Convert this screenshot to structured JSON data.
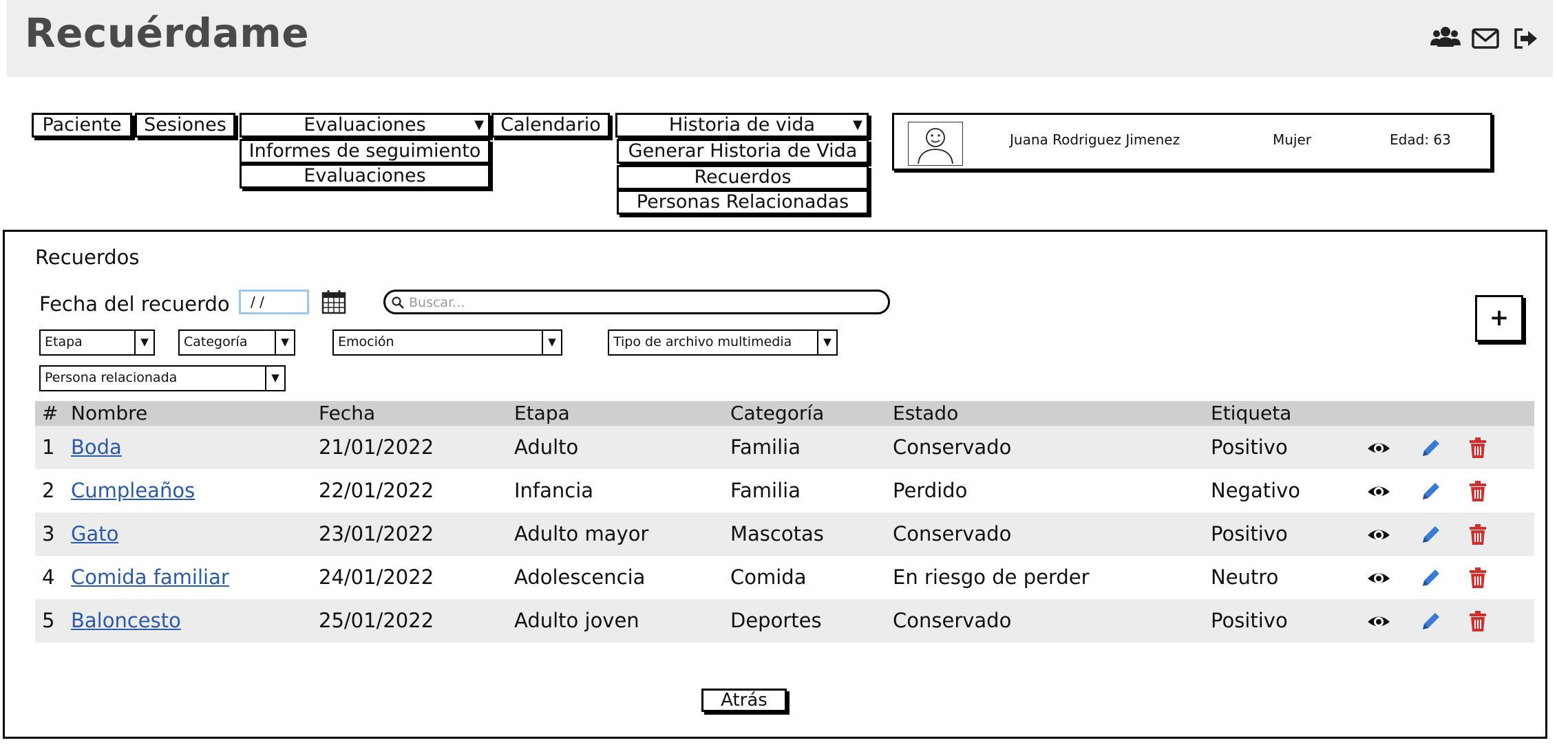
{
  "app": {
    "title": "Recuérdame"
  },
  "header_icons": [
    "users-icon",
    "mail-icon",
    "logout-icon"
  ],
  "menu": {
    "paciente": "Paciente",
    "sesiones": "Sesiones",
    "evaluaciones": {
      "label": "Evaluaciones",
      "items": [
        "Informes de seguimiento",
        "Evaluaciones"
      ]
    },
    "calendario": "Calendario",
    "historia": {
      "label": "Historia de vida",
      "items": [
        "Generar Historia de Vida",
        "Recuerdos",
        "Personas Relacionadas"
      ]
    }
  },
  "patient": {
    "name": "Juana Rodriguez Jimenez",
    "gender": "Mujer",
    "age": "Edad: 63"
  },
  "section": {
    "title": "Recuerdos"
  },
  "filters": {
    "date_label": "Fecha del recuerdo",
    "date_value": " / /",
    "search_placeholder": "Buscar...",
    "add_label": "+",
    "etapa": "Etapa",
    "categoria": "Categoría",
    "emocion": "Emoción",
    "tipo": "Tipo de archivo multimedia",
    "persona": "Persona relacionada"
  },
  "table": {
    "columns": [
      "#",
      "Nombre",
      "Fecha",
      "Etapa",
      "Categoría",
      "Estado",
      "Etiqueta"
    ],
    "rows": [
      [
        "1",
        "Boda",
        "21/01/2022",
        "Adulto",
        "Familia",
        "Conservado",
        "Positivo"
      ],
      [
        "2",
        "Cumpleaños",
        "22/01/2022",
        "Infancia",
        "Familia",
        "Perdido",
        "Negativo"
      ],
      [
        "3",
        "Gato",
        "23/01/2022",
        "Adulto mayor",
        "Mascotas",
        "Conservado",
        "Positivo"
      ],
      [
        "4",
        "Comida familiar",
        "24/01/2022",
        "Adolescencia",
        "Comida",
        "En riesgo de perder",
        "Neutro"
      ],
      [
        "5",
        "Baloncesto",
        "25/01/2022",
        "Adulto joven",
        "Deportes",
        "Conservado",
        "Positivo"
      ]
    ]
  },
  "colors": {
    "link": "#2a5aa8",
    "edit": "#3a7bd5",
    "delete": "#d02f2f",
    "header_bg": "#eeeeee"
  },
  "footer": {
    "back_label": "Atrás"
  }
}
